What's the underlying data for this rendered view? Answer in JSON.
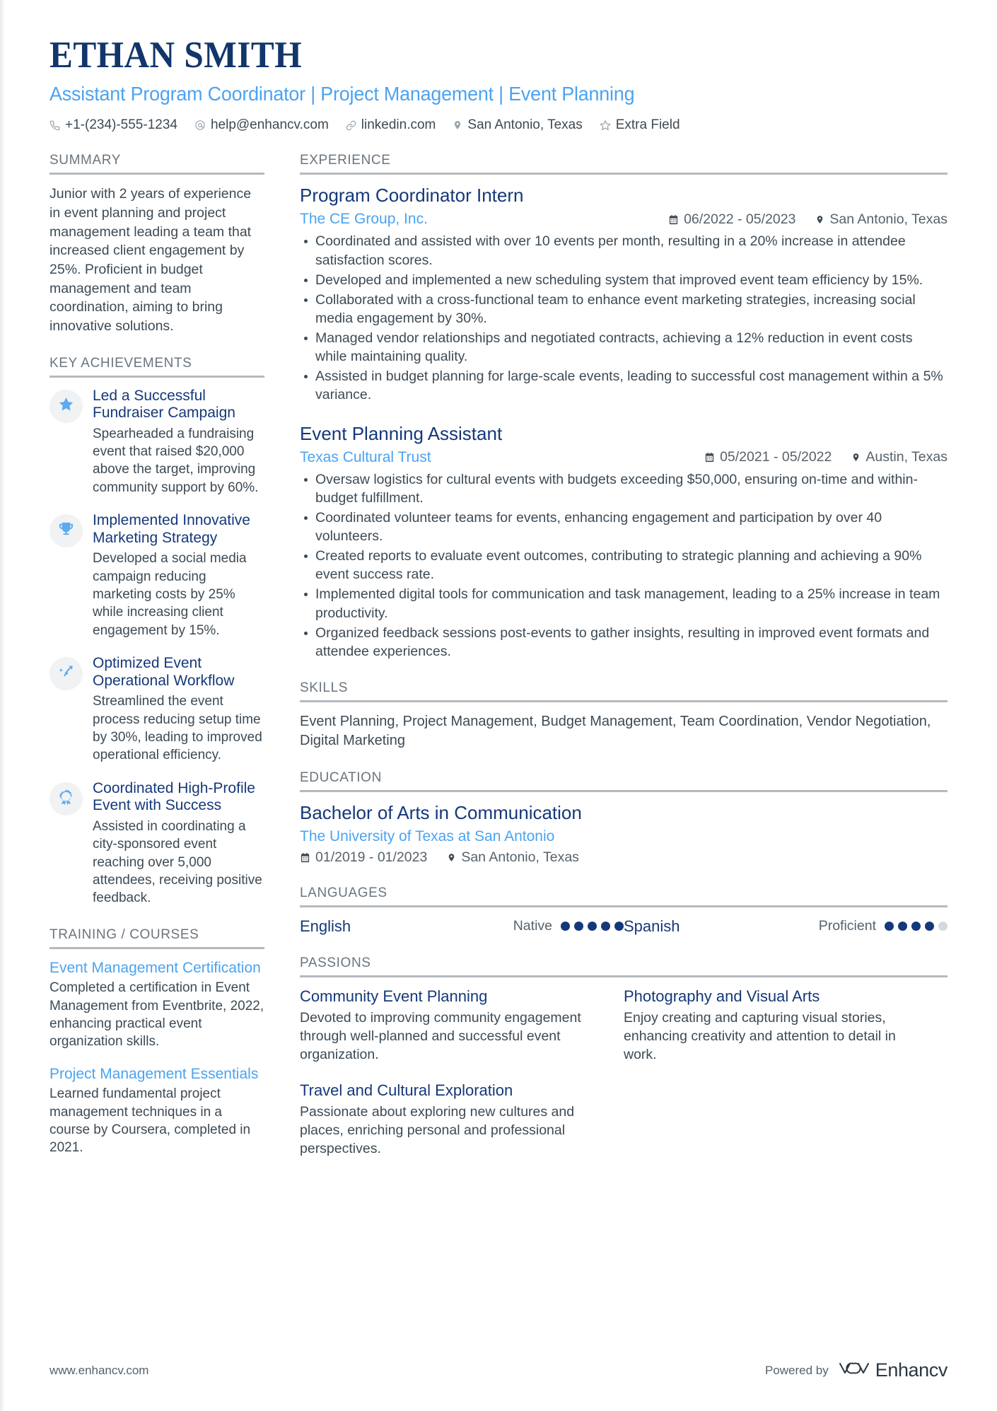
{
  "header": {
    "name": "ETHAN SMITH",
    "headline": "Assistant Program Coordinator | Project Management | Event Planning",
    "contacts": [
      {
        "icon": "phone-icon",
        "text": "+1-(234)-555-1234"
      },
      {
        "icon": "email-icon",
        "text": "help@enhancv.com"
      },
      {
        "icon": "link-icon",
        "text": "linkedin.com"
      },
      {
        "icon": "location-pin-icon",
        "text": "San Antonio, Texas"
      },
      {
        "icon": "star-outline-icon",
        "text": "Extra Field"
      }
    ]
  },
  "colors": {
    "navy": "#15387a",
    "light_blue": "#4ba3f0",
    "body_text": "#3d4a54",
    "section_heading": "#6b757e",
    "rule": "#b6b9bc"
  },
  "left": {
    "summary": {
      "title": "SUMMARY",
      "text": "Junior with 2 years of experience in event planning and project management leading a team that increased client engagement by 25%. Proficient in budget management and team coordination, aiming to bring innovative solutions."
    },
    "key_achievements": {
      "title": "KEY ACHIEVEMENTS",
      "items": [
        {
          "icon": "star-icon",
          "title": "Led a Successful Fundraiser Campaign",
          "desc": "Spearheaded a fundraising event that raised $20,000 above the target, improving community support by 60%."
        },
        {
          "icon": "trophy-icon",
          "title": "Implemented Innovative Marketing Strategy",
          "desc": "Developed a social media campaign reducing marketing costs by 25% while increasing client engagement by 15%."
        },
        {
          "icon": "growth-arrow-icon",
          "title": "Optimized Event Operational Workflow",
          "desc": "Streamlined the event process reducing setup time by 30%, leading to improved operational efficiency."
        },
        {
          "icon": "award-ribbon-icon",
          "title": "Coordinated High-Profile Event with Success",
          "desc": "Assisted in coordinating a city-sponsored event reaching over 5,000 attendees, receiving positive feedback."
        }
      ]
    },
    "training": {
      "title": "TRAINING / COURSES",
      "items": [
        {
          "title": "Event Management Certification",
          "desc": "Completed a certification in Event Management from Eventbrite, 2022, enhancing practical event organization skills."
        },
        {
          "title": "Project Management Essentials",
          "desc": "Learned fundamental project management techniques in a course by Coursera, completed in 2021."
        }
      ]
    }
  },
  "right": {
    "experience": {
      "title": "EXPERIENCE",
      "jobs": [
        {
          "role": "Program Coordinator Intern",
          "company": "The CE Group, Inc.",
          "dates": "06/2022 - 05/2023",
          "location": "San Antonio, Texas",
          "bullets": [
            "Coordinated and assisted with over 10 events per month, resulting in a 20% increase in attendee satisfaction scores.",
            "Developed and implemented a new scheduling system that improved event team efficiency by 15%.",
            "Collaborated with a cross-functional team to enhance event marketing strategies, increasing social media engagement by 30%.",
            "Managed vendor relationships and negotiated contracts, achieving a 12% reduction in event costs while maintaining quality.",
            "Assisted in budget planning for large-scale events, leading to successful cost management within a 5% variance."
          ]
        },
        {
          "role": "Event Planning Assistant",
          "company": "Texas Cultural Trust",
          "dates": "05/2021 - 05/2022",
          "location": "Austin, Texas",
          "bullets": [
            "Oversaw logistics for cultural events with budgets exceeding $50,000, ensuring on-time and within-budget fulfillment.",
            "Coordinated volunteer teams for events, enhancing engagement and participation by over 40 volunteers.",
            "Created reports to evaluate event outcomes, contributing to strategic planning and achieving a 90% event success rate.",
            "Implemented digital tools for communication and task management, leading to a 25% increase in team productivity.",
            "Organized feedback sessions post-events to gather insights, resulting in improved event formats and attendee experiences."
          ]
        }
      ]
    },
    "skills": {
      "title": "SKILLS",
      "text": "Event Planning, Project Management, Budget Management, Team Coordination, Vendor Negotiation, Digital Marketing"
    },
    "education": {
      "title": "EDUCATION",
      "degree": "Bachelor of Arts in Communication",
      "school": "The University of Texas at San Antonio",
      "dates": "01/2019 - 01/2023",
      "location": "San Antonio, Texas"
    },
    "languages": {
      "title": "LANGUAGES",
      "items": [
        {
          "name": "English",
          "level": "Native",
          "filled": 5,
          "total": 5
        },
        {
          "name": "Spanish",
          "level": "Proficient",
          "filled": 4,
          "total": 5
        }
      ]
    },
    "passions": {
      "title": "PASSIONS",
      "items": [
        {
          "title": "Community Event Planning",
          "desc": "Devoted to improving community engagement through well-planned and successful event organization."
        },
        {
          "title": "Photography and Visual Arts",
          "desc": "Enjoy creating and capturing visual stories, enhancing creativity and attention to detail in work."
        },
        {
          "title": "Travel and Cultural Exploration",
          "desc": "Passionate about exploring new cultures and places, enriching personal and professional perspectives."
        }
      ]
    }
  },
  "footer": {
    "url": "www.enhancv.com",
    "powered_by": "Powered by",
    "brand": "Enhancv"
  }
}
